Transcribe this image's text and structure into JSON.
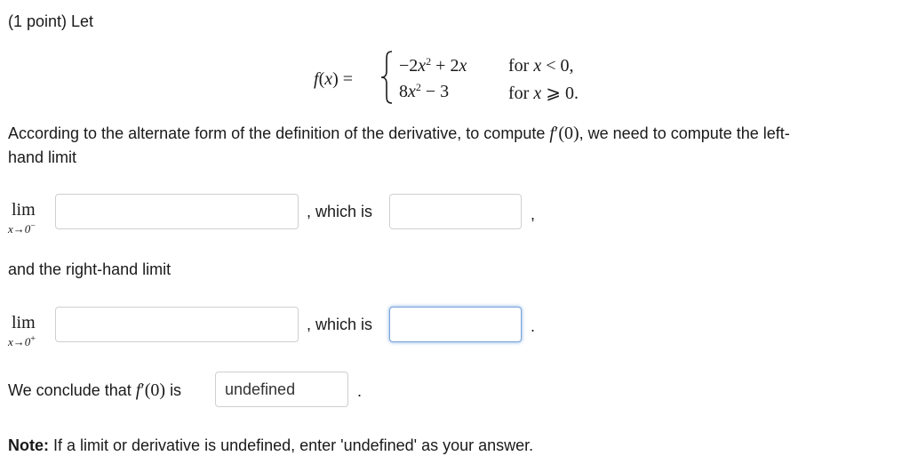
{
  "header": {
    "text": "(1 point) Let"
  },
  "function_def": {
    "lhs": "f(x) =",
    "case1_expr": "−2x² + 2x",
    "case1_cond": "for x < 0,",
    "case2_expr": "8x² − 3",
    "case2_cond": "for x ⩾ 0."
  },
  "intro": {
    "line1_a": "According to the alternate form of the definition of the derivative, to compute",
    "fprime": "f′(0)",
    "line1_b": ", we need to compute the left-",
    "line2": "hand limit"
  },
  "left_limit": {
    "lim": "lim",
    "sub": "x→0",
    "sup": "−",
    "which_is": ", which is",
    "trailing": ","
  },
  "right_intro": "and the right-hand limit",
  "right_limit": {
    "lim": "lim",
    "sub": "x→0",
    "sup": "+",
    "which_is": ", which is",
    "trailing": "."
  },
  "conclude": {
    "text": "We conclude that",
    "fprime": "f′(0)",
    "is": "is",
    "answer": "undefined",
    "trailing": "."
  },
  "note": {
    "label": "Note:",
    "text": "If a limit or derivative is undefined, enter 'undefined' as your answer."
  },
  "colors": {
    "focus_border": "#7aa4d8",
    "box_border": "#cfcfcf"
  }
}
